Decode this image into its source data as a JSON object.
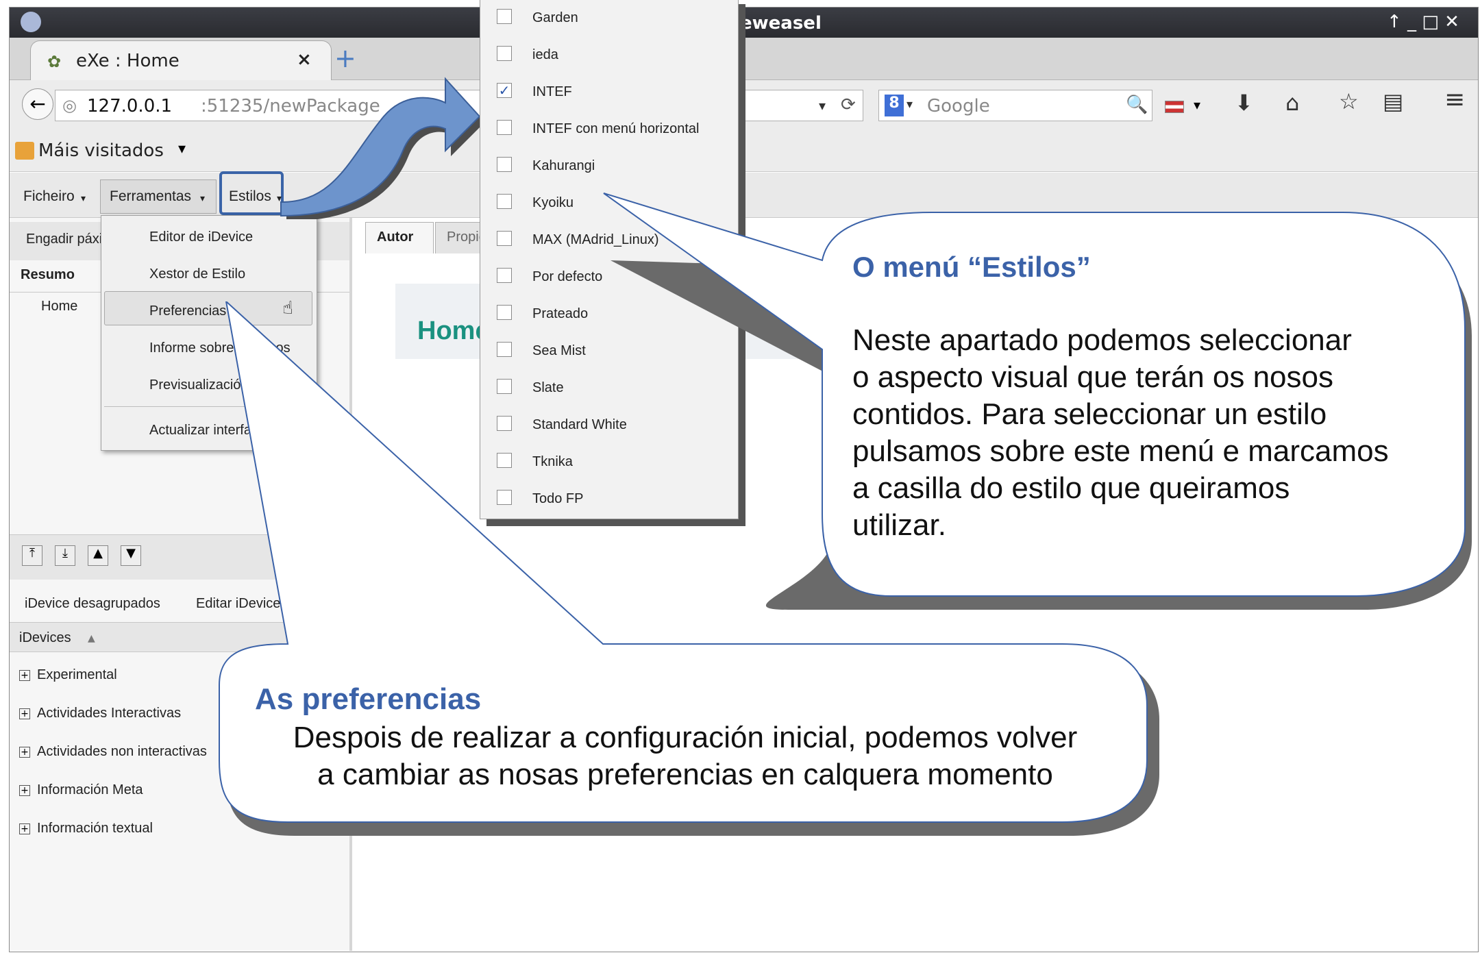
{
  "browser": {
    "window_title": "eweasel",
    "tab_title": "eXe : Home",
    "url_host": "127.0.0.1",
    "url_rest": ":51235/newPackage",
    "search_placeholder": "Google",
    "bookmarks_label": "Máis visitados"
  },
  "menubar": {
    "file": "Ficheiro",
    "tools": "Ferramentas",
    "styles": "Estilos"
  },
  "tools_menu": {
    "items": [
      "Editor de iDevice",
      "Xestor de Estilo",
      "Preferencias",
      "Informe sobre recursos",
      "Previsualización",
      "Actualizar interface"
    ]
  },
  "styles_menu": {
    "items": [
      {
        "label": "Garden",
        "checked": false
      },
      {
        "label": "ieda",
        "checked": false
      },
      {
        "label": "INTEF",
        "checked": true
      },
      {
        "label": "INTEF con menú horizontal",
        "checked": false
      },
      {
        "label": "Kahurangi",
        "checked": false
      },
      {
        "label": "Kyoiku",
        "checked": false
      },
      {
        "label": "MAX (MAdrid_Linux)",
        "checked": false
      },
      {
        "label": "Por defecto",
        "checked": false
      },
      {
        "label": "Prateado",
        "checked": false
      },
      {
        "label": "Sea Mist",
        "checked": false
      },
      {
        "label": "Slate",
        "checked": false
      },
      {
        "label": "Standard White",
        "checked": false
      },
      {
        "label": "Tknika",
        "checked": false
      },
      {
        "label": "Todo FP",
        "checked": false
      }
    ]
  },
  "left_panel": {
    "add_page": "Engadir páxina",
    "outline_header": "Resumo",
    "outline_root": "Home",
    "idevice_tabs": [
      "iDevice desagrupados",
      "Editar iDevices"
    ],
    "idevices_header": "iDevices",
    "categories": [
      "Experimental",
      "Actividades Interactivas",
      "Actividades non interactivas",
      "Información Meta",
      "Información textual"
    ]
  },
  "main_tabs": [
    "Autor",
    "Propiedades"
  ],
  "page_heading": "Home",
  "callout_styles": {
    "title": "O menú “Estilos”",
    "lines": [
      "Neste apartado podemos seleccionar",
      "o aspecto visual que terán os nosos",
      "contidos. Para seleccionar un estilo",
      "pulsamos sobre este menú e marcamos",
      "a casilla do estilo que queiramos",
      "utilizar."
    ]
  },
  "callout_prefs": {
    "title": "As preferencias",
    "lines": [
      "Despois de realizar a configuración inicial, podemos volver",
      "a cambiar as nosas preferencias en calquera momento"
    ]
  }
}
